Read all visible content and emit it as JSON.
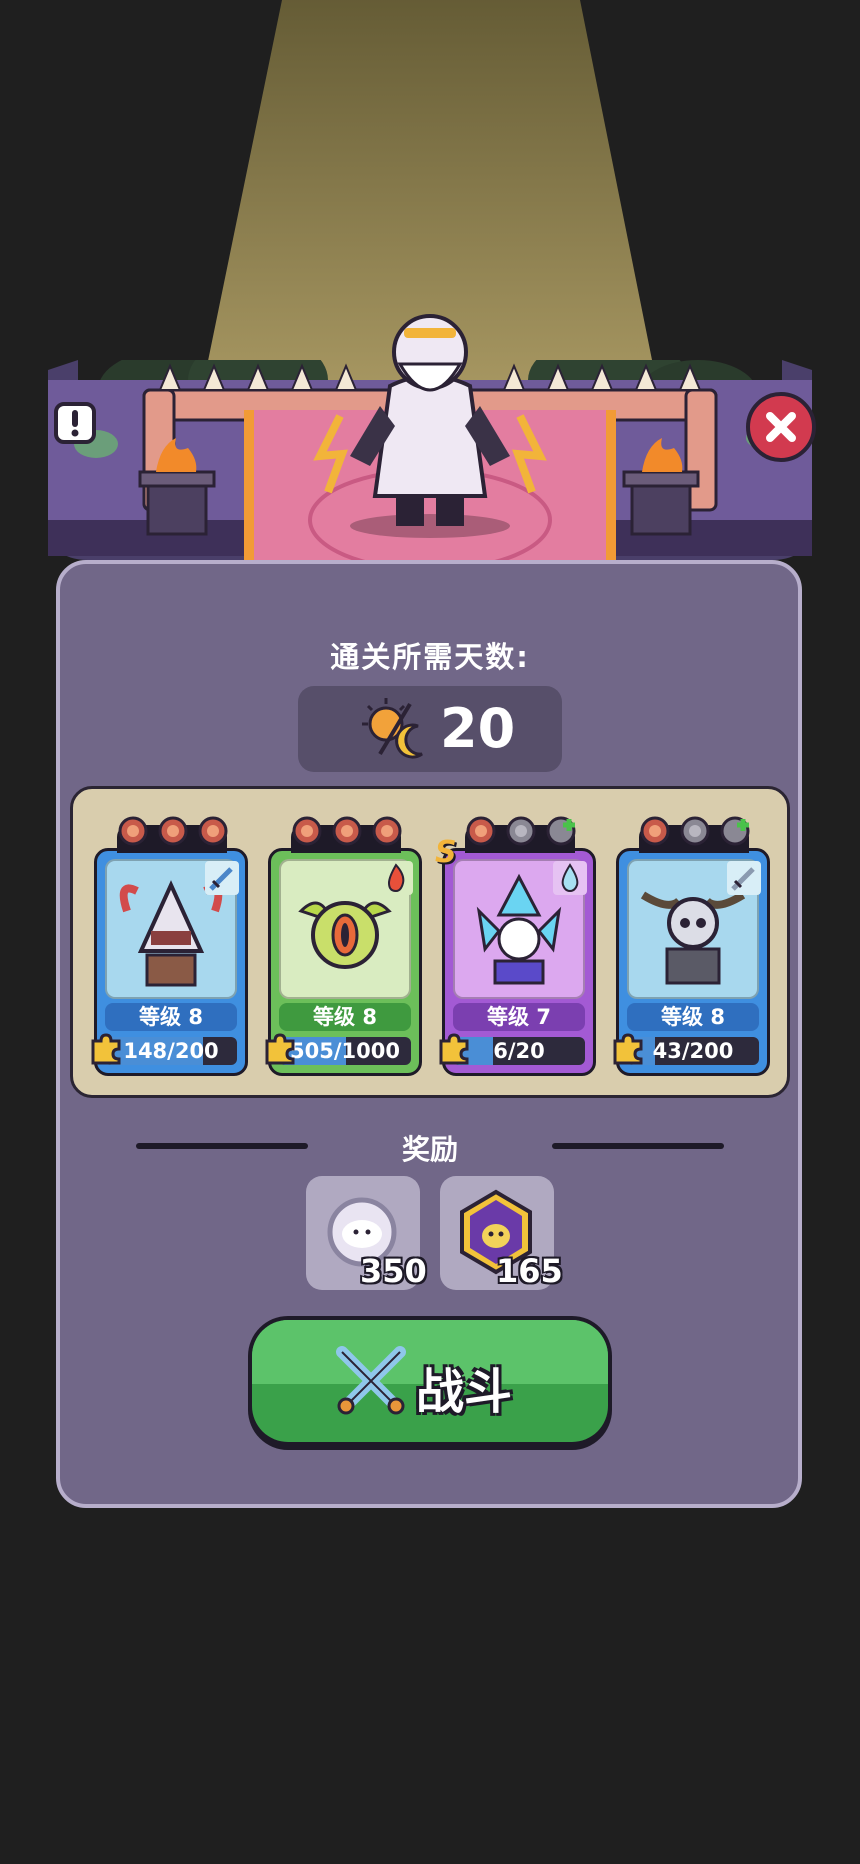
{
  "colors": {
    "background": "#1f1f1f",
    "panel": "#716788",
    "panel_border": "#b7aecb",
    "button": "#3aa14a",
    "close_button": "#d23a4f"
  },
  "stage": {
    "boss_icon": "thunder-god-boss",
    "info_button_icon": "exclamation-icon",
    "close_button_icon": "close-icon"
  },
  "days": {
    "title": "通关所需天数:",
    "value": "20",
    "icon": "sun-moon-icon"
  },
  "heroes": [
    {
      "name_icon": "horned-knight",
      "element_icon": "sword-icon",
      "rarity": "blue",
      "level_label": "等级 8",
      "progress_text": "148/200",
      "progress": 0.74,
      "food": [
        "meat",
        "meat",
        "meat"
      ]
    },
    {
      "name_icon": "eye-dragon",
      "element_icon": "fire-icon",
      "rarity": "green",
      "level_label": "等级 8",
      "progress_text": "505/1000",
      "progress": 0.505,
      "food": [
        "meat",
        "meat",
        "meat"
      ]
    },
    {
      "name_icon": "crystal-mage",
      "element_icon": "water-drop-icon",
      "rarity": "purple",
      "rank": "S",
      "level_label": "等级 7",
      "progress_text": "6/20",
      "progress": 0.3,
      "food": [
        "meat",
        "gray-meat",
        "add"
      ]
    },
    {
      "name_icon": "horned-skeleton",
      "element_icon": "sword-icon",
      "rarity": "blue",
      "level_label": "等级 8",
      "progress_text": "43/200",
      "progress": 0.215,
      "food": [
        "meat",
        "gray-meat",
        "add"
      ]
    }
  ],
  "rewards": {
    "title": "奖励",
    "items": [
      {
        "icon": "spirit-orb-icon",
        "amount": "350"
      },
      {
        "icon": "purple-gem-icon",
        "amount": "165"
      }
    ]
  },
  "fight_button": {
    "label": "战斗",
    "icon": "crossed-swords-icon"
  }
}
